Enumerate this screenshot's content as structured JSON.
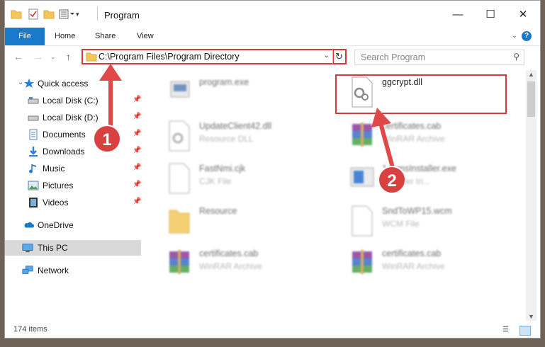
{
  "window": {
    "title": "Program",
    "controls": {
      "minimize": "—",
      "maximize": "☐",
      "close": "✕"
    }
  },
  "ribbon": {
    "tabs": [
      {
        "label": "File"
      },
      {
        "label": "Share"
      },
      {
        "label": "View"
      }
    ],
    "home_label": "Home",
    "help": "?"
  },
  "address_bar": {
    "path": "C:\\Program Files\\Program Directory",
    "search_placeholder": "Search Program"
  },
  "nav": {
    "quick_access": "Quick access",
    "items": [
      {
        "label": "Local Disk (C:)",
        "icon": "drive-icon"
      },
      {
        "label": "Local Disk (D:)",
        "icon": "drive-icon"
      },
      {
        "label": "Documents",
        "icon": "documents-icon"
      },
      {
        "label": "Downloads",
        "icon": "downloads-icon"
      },
      {
        "label": "Music",
        "icon": "music-icon"
      },
      {
        "label": "Pictures",
        "icon": "pictures-icon"
      },
      {
        "label": "Videos",
        "icon": "videos-icon"
      }
    ],
    "onedrive": "OneDrive",
    "this_pc": "This PC",
    "network": "Network"
  },
  "files": [
    {
      "name": "program.exe",
      "type": ""
    },
    {
      "name": "ggcrypt.dll",
      "type": ""
    },
    {
      "name": "UpdateClient42.dll",
      "type": "Resource DLL"
    },
    {
      "name": "certificates.cab",
      "type": "WinRAR Archive"
    },
    {
      "name": "FastNmi.cjk",
      "type": "CJK File"
    },
    {
      "name": "1...rmsInstaller.exe",
      "type": "...reader tri..."
    },
    {
      "name": "Resource",
      "type": ""
    },
    {
      "name": "SndToWP15.wcm",
      "type": "WCM File"
    },
    {
      "name": "certificates.cab",
      "type": "WinRAR Archive"
    },
    {
      "name": "certificates.cab",
      "type": "WinRAR Archive"
    }
  ],
  "status": {
    "item_count": "174 items"
  },
  "annotations": {
    "step1": "1",
    "step2": "2"
  },
  "colors": {
    "accent": "#1979ca",
    "highlight": "#d43a3a"
  }
}
